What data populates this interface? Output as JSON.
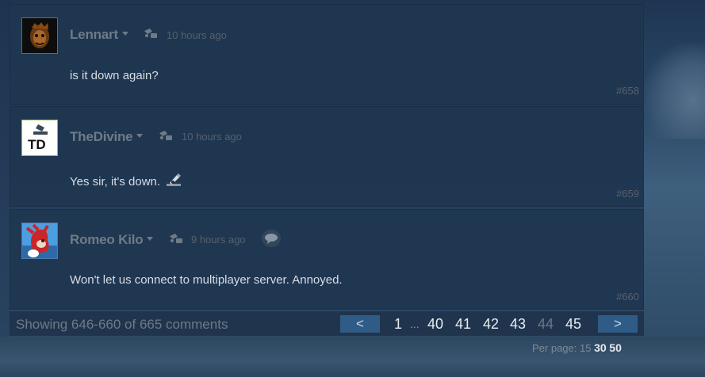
{
  "comments": [
    {
      "author": "Lennart",
      "timestamp": "10 hours ago",
      "text": "is it down again?",
      "number": "#658"
    },
    {
      "author": "TheDivine",
      "timestamp": "10 hours ago",
      "text": "Yes sir, it's down.",
      "number": "#659"
    },
    {
      "author": "Romeo Kilo",
      "timestamp": "9 hours ago",
      "text": "Won't let us connect to multiplayer server. Annoyed.",
      "number": "#660"
    }
  ],
  "pagination": {
    "summary": "Showing 646-660 of 665 comments",
    "prev_label": "<",
    "next_label": ">",
    "ellipsis": "...",
    "pages": [
      "1",
      "40",
      "41",
      "42",
      "43",
      "44",
      "45"
    ],
    "current_page": "44"
  },
  "per_page": {
    "label": "Per page:",
    "options": [
      "15",
      "30",
      "50"
    ]
  },
  "avatar_text": {
    "thedivine": "TD"
  },
  "icons": {
    "author_menu": "chevron-down-icon",
    "owner": "game-owner-icon",
    "emoticon": "emoticon-icon",
    "chat": "chat-bubble-icon"
  },
  "colors": {
    "panel": "#203650",
    "button": "#2f5c86",
    "online_border": "#8bc34a"
  }
}
